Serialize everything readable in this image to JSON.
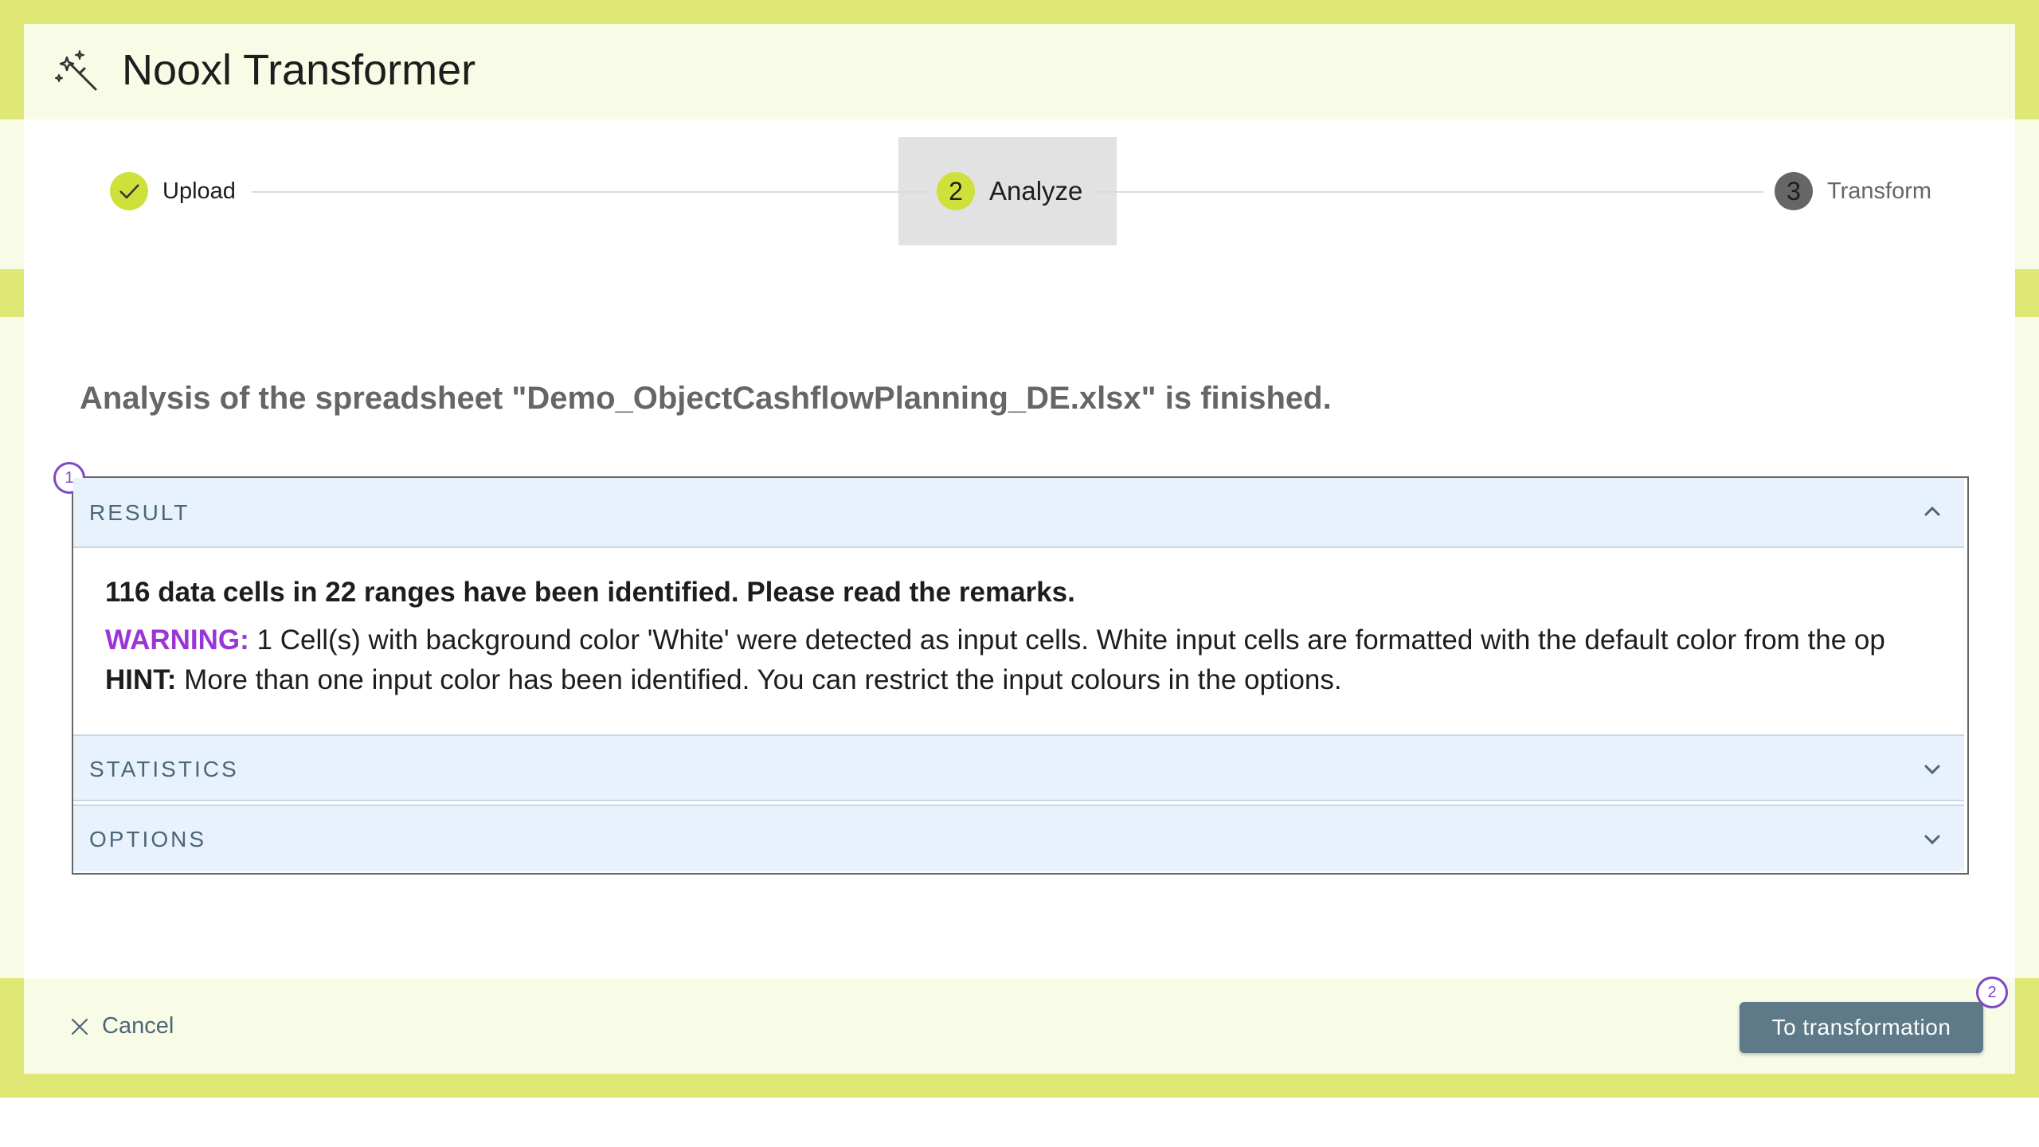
{
  "app": {
    "title": "Nooxl Transformer",
    "icon": "magic-wand-icon"
  },
  "stepper": {
    "steps": [
      {
        "label": "Upload",
        "state": "done",
        "icon": "check-icon"
      },
      {
        "label": "Analyze",
        "number": "2",
        "state": "active"
      },
      {
        "label": "Transform",
        "number": "3",
        "state": "pending"
      }
    ],
    "colors": {
      "done": "#cfe03a",
      "active": "#cfe03a",
      "pending": "#666666"
    }
  },
  "main": {
    "analysis_title": "Analysis of the spreadsheet \"Demo_ObjectCashflowPlanning_DE.xlsx\" is finished.",
    "badge_1": "1",
    "accordion": {
      "result": {
        "title": "RESULT",
        "expanded": true,
        "summary": "116 data cells in 22 ranges have been identified. Please read the remarks.",
        "warning_label": "WARNING:",
        "warning_text": " 1 Cell(s) with background color 'White' were detected as input cells. White input cells are formatted with the default color from the op",
        "hint_label": "HINT:",
        "hint_text": " More than one input color has been identified. You can restrict the input colours in the options."
      },
      "statistics": {
        "title": "STATISTICS",
        "expanded": false
      },
      "options": {
        "title": "OPTIONS",
        "expanded": false
      }
    }
  },
  "footer": {
    "cancel_label": "Cancel",
    "primary_label": "To transformation",
    "badge_2": "2"
  },
  "colors": {
    "frame": "#dfe875",
    "header_bg": "#f8fbe6",
    "accordion_bg": "#e8f2fc",
    "warning": "#9b35d6",
    "badge": "#7e46c9",
    "primary_button": "#5e7987"
  }
}
